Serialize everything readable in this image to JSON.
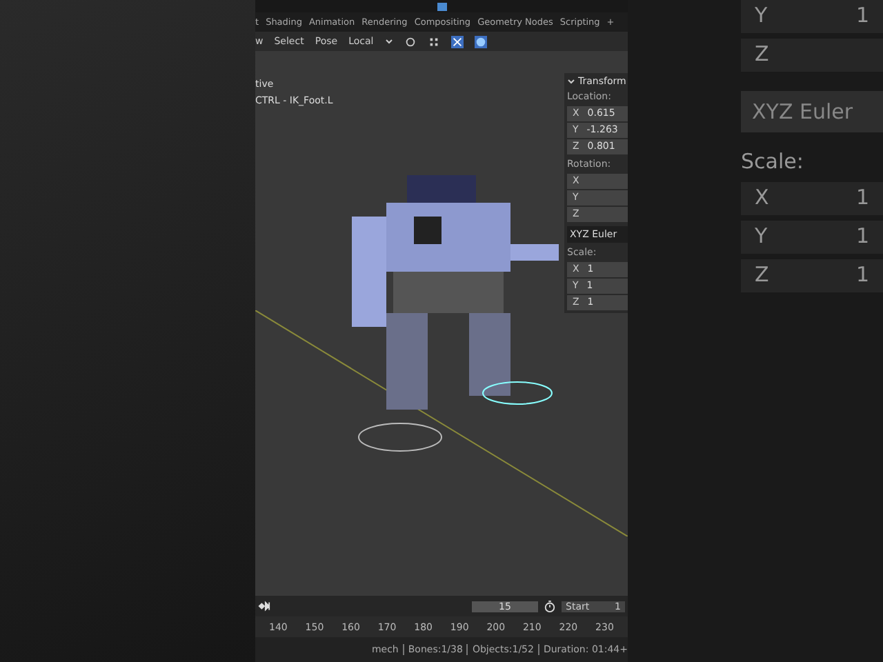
{
  "workspace_tabs": [
    {
      "label": "t",
      "selected": false
    },
    {
      "label": "Shading",
      "selected": false
    },
    {
      "label": "Animation",
      "selected": false
    },
    {
      "label": "Rendering",
      "selected": false
    },
    {
      "label": "Compositing",
      "selected": false
    },
    {
      "label": "Geometry Nodes",
      "selected": false
    },
    {
      "label": "Scripting",
      "selected": false
    }
  ],
  "add_tab": "+",
  "header_menus": [
    "w",
    "Select",
    "Pose"
  ],
  "orientation": "Local",
  "viewport": {
    "mode_text": "tive",
    "bone_text": "CTRL - IK_Foot.L"
  },
  "transform": {
    "title": "Transform",
    "location_label": "Location:",
    "location": [
      {
        "axis": "X",
        "value": "0.615"
      },
      {
        "axis": "Y",
        "value": "-1.263"
      },
      {
        "axis": "Z",
        "value": "0.801"
      }
    ],
    "rotation_label": "Rotation:",
    "rotation": [
      {
        "axis": "X"
      },
      {
        "axis": "Y"
      },
      {
        "axis": "Z"
      }
    ],
    "rotation_mode": "XYZ Euler",
    "scale_label": "Scale:",
    "scale": [
      {
        "axis": "X",
        "value": "1"
      },
      {
        "axis": "Y",
        "value": "1"
      },
      {
        "axis": "Z",
        "value": "1"
      }
    ]
  },
  "timeline": {
    "frame": "15",
    "start_label": "Start",
    "start_value": "1",
    "ticks": [
      "140",
      "150",
      "160",
      "170",
      "180",
      "190",
      "200",
      "210",
      "220",
      "230"
    ]
  },
  "status_bar": [
    "mech",
    "Bones:1/38",
    "Objects:1/52",
    "Duration: 01:44+"
  ],
  "backdrop_right": {
    "rows": [
      {
        "axis": "Y",
        "value": "1"
      },
      {
        "axis": "Z"
      }
    ],
    "rotation_mode": "XYZ Euler",
    "scale_label": "Scale:",
    "scale": [
      {
        "axis": "X",
        "value": "1"
      },
      {
        "axis": "Y",
        "value": "1"
      },
      {
        "axis": "Z",
        "value": "1"
      }
    ]
  }
}
